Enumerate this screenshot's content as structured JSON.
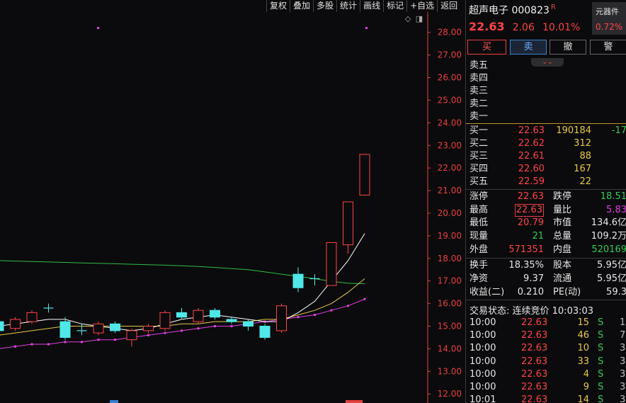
{
  "toolbar": {
    "items": [
      "复权",
      "叠加",
      "多股",
      "统计",
      "画线",
      "标记",
      "+自选",
      "返回"
    ]
  },
  "stock": {
    "name_code": "超声电子 000823",
    "flag": "R",
    "price": "22.63",
    "change": "2.06",
    "change_pct": "10.01%",
    "sector_name": "元器件",
    "sector_pct": "0.72%"
  },
  "buttons": {
    "buy": "买",
    "sell": "卖",
    "cancel": "撤",
    "alert": "警"
  },
  "order_book": {
    "asks": [
      {
        "label": "卖五"
      },
      {
        "label": "卖四"
      },
      {
        "label": "卖三"
      },
      {
        "label": "卖二"
      },
      {
        "label": "卖一"
      }
    ],
    "bids": [
      {
        "label": "买一",
        "price": "22.63",
        "volume": "190184",
        "change": "-17"
      },
      {
        "label": "买二",
        "price": "22.62",
        "volume": "312",
        "change": ""
      },
      {
        "label": "买三",
        "price": "22.61",
        "volume": "88",
        "change": ""
      },
      {
        "label": "买四",
        "price": "22.60",
        "volume": "167",
        "change": ""
      },
      {
        "label": "买五",
        "price": "22.59",
        "volume": "22",
        "change": ""
      }
    ]
  },
  "stats": [
    {
      "k1": "涨停",
      "v1": "22.63",
      "c1": "red",
      "k2": "跌停",
      "v2": "18.51",
      "c2": "grn"
    },
    {
      "k1": "最高",
      "v1": "22.63",
      "c1": "red",
      "k2": "量比",
      "v2": "5.83",
      "c2": "mag"
    },
    {
      "k1": "最低",
      "v1": "20.79",
      "c1": "red",
      "k2": "市值",
      "v2": "134.6亿",
      "c2": "wht"
    },
    {
      "k1": "现量",
      "v1": "21",
      "c1": "grn",
      "k2": "总量",
      "v2": "109.2万",
      "c2": "wht"
    },
    {
      "k1": "外盘",
      "v1": "571351",
      "c1": "red",
      "k2": "内盘",
      "v2": "520169",
      "c2": "grn"
    },
    {
      "k1": "换手",
      "v1": "18.35%",
      "c1": "wht",
      "k2": "股本",
      "v2": "5.95亿",
      "c2": "wht"
    },
    {
      "k1": "净资",
      "v1": "9.37",
      "c1": "wht",
      "k2": "流通",
      "v2": "5.95亿",
      "c2": "wht"
    },
    {
      "k1": "收益(二)",
      "v1": "0.210",
      "c1": "wht",
      "k2": "PE(动)",
      "v2": "59.3",
      "c2": "wht"
    }
  ],
  "trade_status": "交易状态: 连续竞价 10:03:03",
  "ticks": [
    {
      "time": "10:00",
      "price": "22.63",
      "vol": "15",
      "side": "S",
      "n": "1"
    },
    {
      "time": "10:00",
      "price": "22.63",
      "vol": "46",
      "side": "S",
      "n": "7"
    },
    {
      "time": "10:00",
      "price": "22.63",
      "vol": "10",
      "side": "S",
      "n": "3"
    },
    {
      "time": "10:00",
      "price": "22.63",
      "vol": "33",
      "side": "S",
      "n": "3"
    },
    {
      "time": "10:00",
      "price": "22.63",
      "vol": "4",
      "side": "S",
      "n": "3"
    },
    {
      "time": "10:00",
      "price": "22.63",
      "vol": "9",
      "side": "S",
      "n": "3"
    },
    {
      "time": "10:01",
      "price": "22.63",
      "vol": "14",
      "side": "S",
      "n": "3"
    }
  ],
  "colors": {
    "up": "#ff4444",
    "down": "#4fe8e8",
    "ma5": "#ffffff",
    "ma10": "#e8c84a",
    "ma20": "#e040e0",
    "ma60": "#33bb44",
    "axis": "#e84040"
  },
  "chart_data": {
    "type": "candlestick",
    "y_ticks": [
      "28.00",
      "27.00",
      "26.00",
      "25.00",
      "24.00",
      "23.00",
      "22.00",
      "21.00",
      "20.00",
      "19.00",
      "18.00",
      "17.00",
      "16.00",
      "15.00",
      "14.00",
      "13.00",
      "12.00"
    ],
    "ylim": [
      11.6,
      28.9
    ],
    "candles": [
      {
        "o": 15.2,
        "c": 14.8,
        "h": 15.3,
        "l": 14.7
      },
      {
        "o": 14.9,
        "c": 15.3,
        "h": 15.4,
        "l": 14.8
      },
      {
        "o": 15.2,
        "c": 15.6,
        "h": 15.7,
        "l": 15.1
      },
      {
        "o": 15.8,
        "c": 15.8,
        "h": 16.0,
        "l": 15.6
      },
      {
        "o": 15.2,
        "c": 14.5,
        "h": 15.4,
        "l": 14.4
      },
      {
        "o": 14.8,
        "c": 14.8,
        "h": 15.1,
        "l": 14.6
      },
      {
        "o": 14.7,
        "c": 15.1,
        "h": 15.2,
        "l": 14.6
      },
      {
        "o": 15.1,
        "c": 14.8,
        "h": 15.2,
        "l": 14.7
      },
      {
        "o": 14.4,
        "c": 14.8,
        "h": 14.9,
        "l": 14.1
      },
      {
        "o": 14.8,
        "c": 15.0,
        "h": 15.1,
        "l": 14.7
      },
      {
        "o": 14.9,
        "c": 15.6,
        "h": 15.7,
        "l": 14.8
      },
      {
        "o": 15.6,
        "c": 15.4,
        "h": 15.8,
        "l": 15.3
      },
      {
        "o": 15.2,
        "c": 15.7,
        "h": 15.8,
        "l": 15.1
      },
      {
        "o": 15.7,
        "c": 15.4,
        "h": 15.8,
        "l": 15.3
      },
      {
        "o": 15.3,
        "c": 15.2,
        "h": 15.4,
        "l": 15.1
      },
      {
        "o": 15.2,
        "c": 15.0,
        "h": 15.3,
        "l": 14.8
      },
      {
        "o": 15.0,
        "c": 14.5,
        "h": 15.1,
        "l": 14.4
      },
      {
        "o": 14.8,
        "c": 15.9,
        "h": 16.0,
        "l": 14.7
      },
      {
        "o": 17.3,
        "c": 16.7,
        "h": 17.6,
        "l": 16.5
      },
      {
        "o": 17.1,
        "c": 17.1,
        "h": 17.3,
        "l": 16.8
      },
      {
        "o": 16.8,
        "c": 18.7,
        "h": 18.7,
        "l": 16.8
      },
      {
        "o": 18.6,
        "c": 20.5,
        "h": 20.5,
        "l": 18.2
      },
      {
        "o": 20.8,
        "c": 22.6,
        "h": 22.63,
        "l": 20.79
      }
    ],
    "ma5": [
      15.0,
      15.1,
      15.2,
      15.3,
      15.3,
      15.1,
      15.0,
      14.9,
      14.8,
      14.9,
      15.1,
      15.3,
      15.4,
      15.5,
      15.4,
      15.3,
      15.2,
      15.2,
      15.6,
      16.1,
      17.0,
      17.9,
      19.1
    ],
    "ma10": [
      14.6,
      14.7,
      14.8,
      14.9,
      15.0,
      15.0,
      15.0,
      15.0,
      15.0,
      15.0,
      15.0,
      15.1,
      15.1,
      15.2,
      15.2,
      15.2,
      15.3,
      15.3,
      15.5,
      15.7,
      16.0,
      16.5,
      17.1
    ],
    "ma20": [
      14.0,
      14.1,
      14.2,
      14.2,
      14.3,
      14.3,
      14.4,
      14.4,
      14.5,
      14.6,
      14.7,
      14.8,
      14.9,
      15.0,
      15.0,
      15.1,
      15.2,
      15.3,
      15.4,
      15.5,
      15.7,
      15.9,
      16.2
    ],
    "ma60": [
      17.9,
      17.88,
      17.86,
      17.84,
      17.82,
      17.8,
      17.78,
      17.76,
      17.74,
      17.72,
      17.7,
      17.67,
      17.64,
      17.6,
      17.55,
      17.5,
      17.4,
      17.3,
      17.2,
      17.1,
      16.98,
      16.9,
      16.88
    ]
  }
}
